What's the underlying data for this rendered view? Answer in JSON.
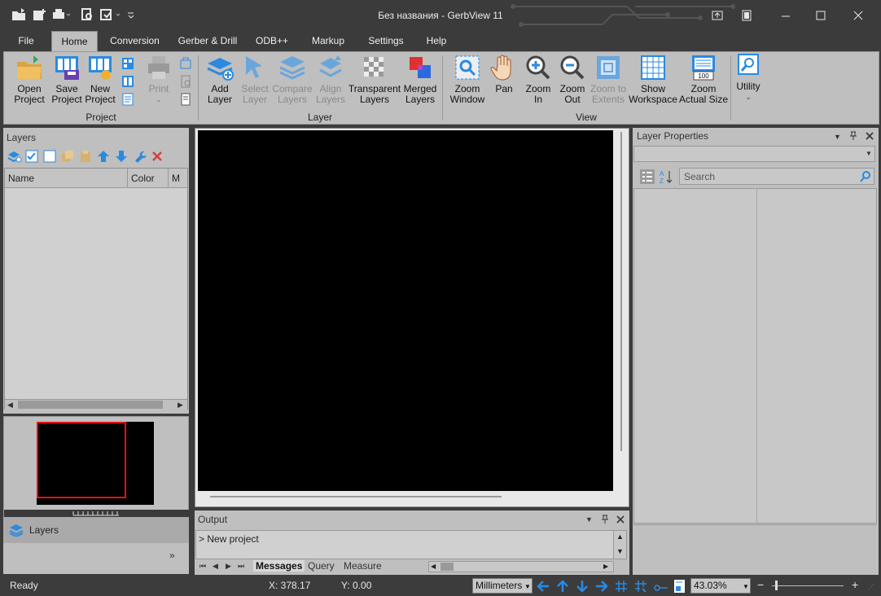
{
  "window": {
    "title": "Без названия - GerbView 11"
  },
  "menu": {
    "tabs": [
      {
        "label": "File"
      },
      {
        "label": "Home"
      },
      {
        "label": "Conversion"
      },
      {
        "label": "Gerber & Drill"
      },
      {
        "label": "ODB++"
      },
      {
        "label": "Markup"
      },
      {
        "label": "Settings"
      },
      {
        "label": "Help"
      }
    ],
    "active": "Home"
  },
  "ribbon": {
    "project": {
      "group_label": "Project",
      "open": "Open\nProject",
      "save": "Save\nProject",
      "new": "New\nProject",
      "print": "Print"
    },
    "layer": {
      "group_label": "Layer",
      "add": "Add\nLayer",
      "select": "Select\nLayer",
      "compare": "Compare\nLayers",
      "align": "Align\nLayers",
      "transparent": "Transparent\nLayers",
      "merged": "Merged\nLayers"
    },
    "view": {
      "group_label": "View",
      "zoom_window": "Zoom\nWindow",
      "pan": "Pan",
      "zoom_in": "Zoom\nIn",
      "zoom_out": "Zoom\nOut",
      "zoom_extents": "Zoom to\nExtents",
      "show_workspace": "Show\nWorkspace",
      "zoom_actual": "Zoom\nActual Size",
      "zoom_actual_badge": "100"
    },
    "utility": {
      "label": "Utility"
    }
  },
  "layers_panel": {
    "title": "Layers",
    "columns": [
      "Name",
      "Color",
      "M"
    ],
    "tab_label": "Layers"
  },
  "output_panel": {
    "title": "Output",
    "lines": [
      "> New project"
    ],
    "tabs": [
      "Messages",
      "Query",
      "Measure"
    ],
    "active_tab": "Messages"
  },
  "props_panel": {
    "title": "Layer Properties",
    "search_placeholder": "Search"
  },
  "status": {
    "state": "Ready",
    "x": "X: 378.17",
    "y": "Y: 0.00",
    "units": "Millimeters",
    "zoom": "43.03%"
  },
  "colors": {
    "title_bg": "#3b3b3b",
    "panel_bg": "#bfbfbf",
    "accent_blue": "#2a8ae0",
    "canvas": "#000000",
    "viewport_frame": "#ff0000"
  }
}
